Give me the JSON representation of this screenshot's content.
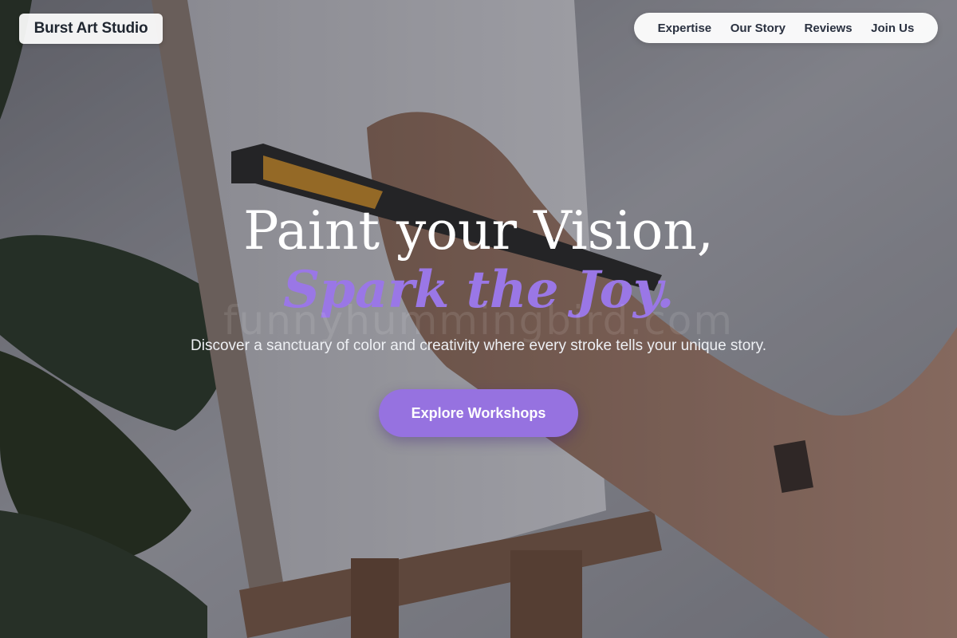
{
  "header": {
    "logo": "Burst Art Studio",
    "nav": [
      "Expertise",
      "Our Story",
      "Reviews",
      "Join Us"
    ]
  },
  "hero": {
    "title_line1": "Paint your Vision,",
    "title_line2": "Spark the Joy.",
    "watermark": "funnyhummingbird.com",
    "tagline": "Discover a sanctuary of color and creativity where every stroke tells your unique story.",
    "cta_label": "Explore Workshops"
  },
  "colors": {
    "accent": "#9672e0",
    "accent_text": "#9a77e6",
    "nav_bg": "#ffffff",
    "nav_text": "#2a3140"
  },
  "background": {
    "image": "artist-painting-canvas-on-easel-photo"
  }
}
